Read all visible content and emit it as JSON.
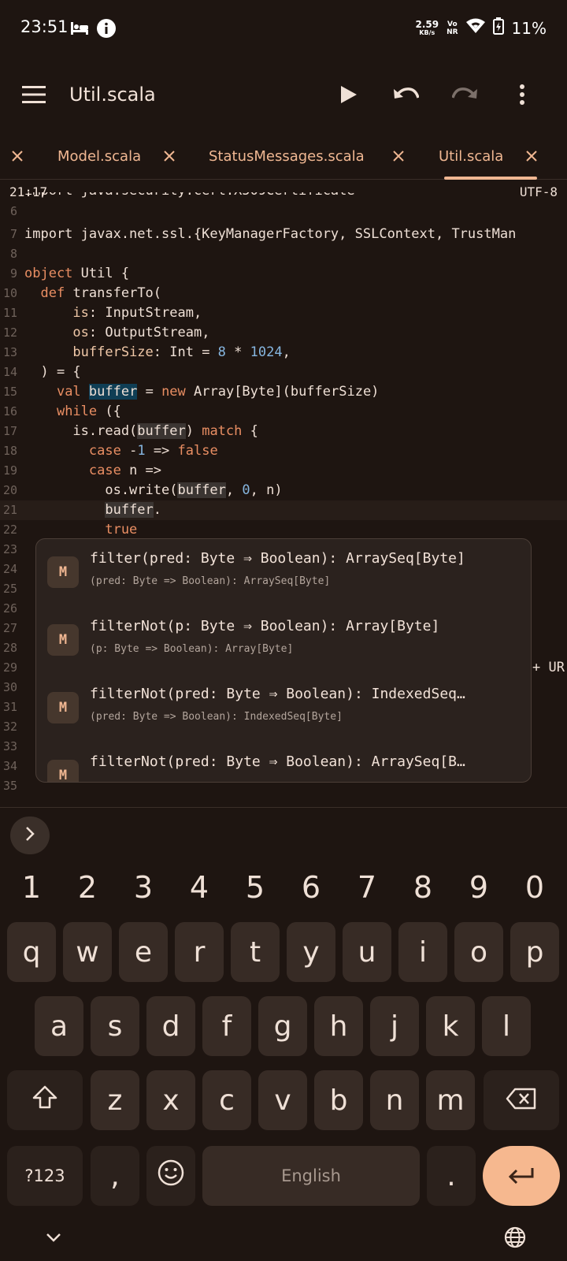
{
  "status_bar": {
    "time": "23:51",
    "net_speed_value": "2.59",
    "net_speed_unit": "KB/s",
    "network_label_top": "Vo",
    "network_label_bottom": "NR",
    "battery": "11%"
  },
  "app_bar": {
    "title": "Util.scala",
    "icons": [
      "menu-icon",
      "play-icon",
      "undo-icon",
      "redo-icon",
      "more-vert-icon"
    ]
  },
  "tabs": [
    {
      "label": "Model.scala",
      "active": false
    },
    {
      "label": "StatusMessages.scala",
      "active": false
    },
    {
      "label": "Util.scala",
      "active": true
    }
  ],
  "editor": {
    "cursor_position": "21:17",
    "encoding": "UTF-8",
    "lines": [
      {
        "n": "6",
        "text": ""
      },
      {
        "n": "7",
        "text": "import javax.net.ssl.{KeyManagerFactory, SSLContext, TrustMan"
      },
      {
        "n": "8",
        "text": ""
      },
      {
        "n": "9",
        "text": "object Util {"
      },
      {
        "n": "10",
        "text": "  def transferTo("
      },
      {
        "n": "11",
        "text": "      is: InputStream,"
      },
      {
        "n": "12",
        "text": "      os: OutputStream,"
      },
      {
        "n": "13",
        "text": "      bufferSize: Int = 8 * 1024,"
      },
      {
        "n": "14",
        "text": "  ) = {"
      },
      {
        "n": "15",
        "text": "    val buffer = new Array[Byte](bufferSize)"
      },
      {
        "n": "16",
        "text": "    while ({"
      },
      {
        "n": "17",
        "text": "      is.read(buffer) match {"
      },
      {
        "n": "18",
        "text": "        case -1 => false"
      },
      {
        "n": "19",
        "text": "        case n =>"
      },
      {
        "n": "20",
        "text": "          os.write(buffer, 0, n)"
      },
      {
        "n": "21",
        "text": "          buffer."
      },
      {
        "n": "22",
        "text": "          true"
      },
      {
        "n": "23",
        "text": ""
      },
      {
        "n": "24",
        "text": ""
      },
      {
        "n": "25",
        "text": ""
      },
      {
        "n": "26",
        "text": ""
      },
      {
        "n": "27",
        "text": ""
      },
      {
        "n": "28",
        "text": ""
      },
      {
        "n": "29",
        "text": "+ UR"
      },
      {
        "n": "30",
        "text": ""
      },
      {
        "n": "31",
        "text": ""
      },
      {
        "n": "32",
        "text": ""
      },
      {
        "n": "33",
        "text": ""
      },
      {
        "n": "34",
        "text": ""
      },
      {
        "n": "35",
        "text": ""
      }
    ]
  },
  "completion": {
    "items": [
      {
        "badge": "M",
        "signature": "filter(pred: Byte ⇒ Boolean): ArraySeq[Byte]",
        "detail": "(pred: Byte => Boolean): ArraySeq[Byte]"
      },
      {
        "badge": "M",
        "signature": "filterNot(p: Byte ⇒ Boolean): Array[Byte]",
        "detail": "(p: Byte => Boolean): Array[Byte]"
      },
      {
        "badge": "M",
        "signature": "filterNot(pred: Byte ⇒ Boolean): IndexedSeq…",
        "detail": "(pred: Byte => Boolean): IndexedSeq[Byte]"
      },
      {
        "badge": "M",
        "signature": "filterNot(pred: Byte ⇒ Boolean): ArraySeq[B…",
        "detail": ""
      }
    ]
  },
  "keyboard": {
    "numbers": [
      "1",
      "2",
      "3",
      "4",
      "5",
      "6",
      "7",
      "8",
      "9",
      "0"
    ],
    "row1": [
      "q",
      "w",
      "e",
      "r",
      "t",
      "y",
      "u",
      "i",
      "o",
      "p"
    ],
    "row2": [
      "a",
      "s",
      "d",
      "f",
      "g",
      "h",
      "j",
      "k",
      "l"
    ],
    "row3": [
      "z",
      "x",
      "c",
      "v",
      "b",
      "n",
      "m"
    ],
    "symbols_label": "?123",
    "comma": ",",
    "space_label": "English",
    "period": "."
  },
  "colors": {
    "background": "#1e1511",
    "accent": "#f0b792",
    "enter_key": "#f6b88f",
    "keyword": "#e98e63",
    "number": "#86b6e0"
  }
}
